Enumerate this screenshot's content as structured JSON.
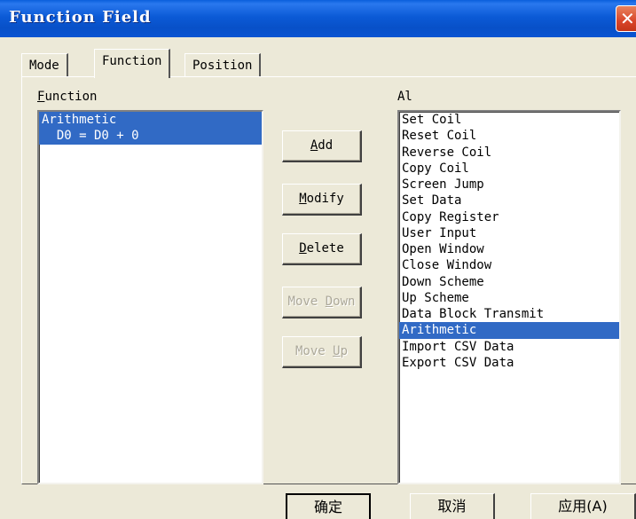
{
  "window": {
    "title": "Function Field",
    "close_glyph": "✕"
  },
  "tabs": [
    {
      "label": "Mode",
      "active": false
    },
    {
      "label": "Function",
      "active": true
    },
    {
      "label": "Position",
      "active": false
    }
  ],
  "function_list": {
    "label": "Function",
    "items": [
      "Arithmetic",
      "  D0 = D0 + 0"
    ]
  },
  "action_list": {
    "label": "Al",
    "items": [
      "Set Coil",
      "Reset Coil",
      "Reverse Coil",
      "Copy Coil",
      "Screen Jump",
      "Set Data",
      "Copy Register",
      "User Input",
      "Open Window",
      "Close Window",
      "Down Scheme",
      "Up Scheme",
      "Data Block Transmit",
      "Arithmetic",
      "Import CSV Data",
      "Export CSV Data"
    ],
    "selected": "Arithmetic"
  },
  "buttons": {
    "add": "Add",
    "modify": "Modify",
    "delete": "Delete",
    "move_down": "Move Down",
    "move_up": "Move Up"
  },
  "footer": {
    "ok": "确定",
    "cancel": "取消",
    "apply": "应用(A)"
  },
  "colors": {
    "selection": "#316ac5",
    "titlebar": "#0a55d2",
    "face": "#ece9d8"
  }
}
